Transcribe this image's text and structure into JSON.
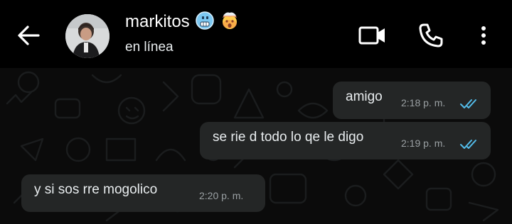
{
  "header": {
    "contact_name": "markitos",
    "status": "en línea",
    "name_emojis": [
      "cold-face-emoji",
      "exploding-head-emoji"
    ]
  },
  "icons": {
    "back": "arrow-left-icon",
    "video": "video-camera-icon",
    "call": "phone-icon",
    "menu": "more-vertical-icon"
  },
  "messages": [
    {
      "direction": "outgoing",
      "text": "amigo",
      "time": "2:18 p. m.",
      "read": true
    },
    {
      "direction": "outgoing",
      "text": "se rie d todo lo qe le digo",
      "time": "2:19 p. m.",
      "read": true
    },
    {
      "direction": "incoming",
      "text": "y si sos rre mogolico",
      "time": "2:20 p. m."
    }
  ],
  "colors": {
    "header_bg": "#000000",
    "chat_bg": "#0b0b0b",
    "bubble_bg": "#242626",
    "read_tick": "#53bdeb",
    "text": "#e9edef",
    "meta": "#9aa0a3"
  }
}
